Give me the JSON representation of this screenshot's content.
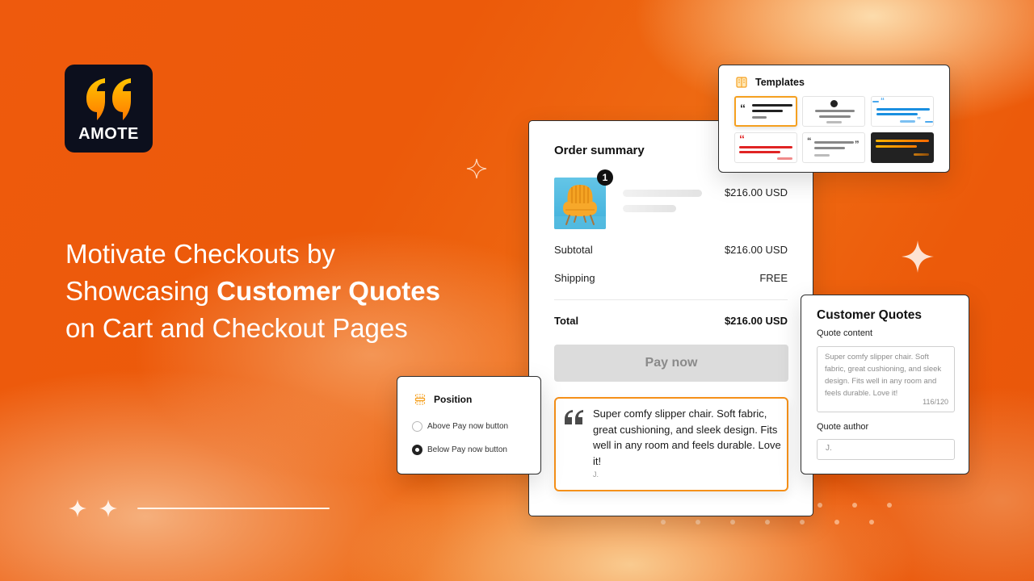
{
  "brand": {
    "logo_text": "AMOTE",
    "logo_icon": "quote-marks-icon",
    "colors": {
      "logo_bg": "#0c0f1d",
      "accent": "#f59019",
      "bg_orange": "#ec5a0a"
    }
  },
  "headline": {
    "line1": "Motivate Checkouts by",
    "line2_regular": "Showcasing ",
    "line2_bold": "Customer Quotes",
    "line3": "on Cart and Checkout Pages"
  },
  "order_summary": {
    "title": "Order summary",
    "item": {
      "image": "orange-armchair",
      "quantity_badge": "1",
      "price": "$216.00 USD"
    },
    "subtotal_label": "Subtotal",
    "subtotal_value": "$216.00 USD",
    "shipping_label": "Shipping",
    "shipping_value": "FREE",
    "total_label": "Total",
    "total_value": "$216.00 USD",
    "pay_button": "Pay now",
    "quote": {
      "text": "Super comfy slipper chair. Soft fabric, great cushioning, and sleek design. Fits well in any room and feels durable. Love it!",
      "author": "J."
    }
  },
  "templates_panel": {
    "title": "Templates",
    "icon": "book-icon",
    "items": [
      {
        "name": "classic-dark",
        "selected": true,
        "color": "#222222"
      },
      {
        "name": "centered-grey",
        "selected": false,
        "color": "#888888"
      },
      {
        "name": "blue-bordered",
        "selected": false,
        "color": "#1a8fe0"
      },
      {
        "name": "red-accent",
        "selected": false,
        "color": "#e02424"
      },
      {
        "name": "inline-quotes-grey",
        "selected": false,
        "color": "#888888"
      },
      {
        "name": "dark-gradient",
        "selected": false,
        "color": "#f59019"
      }
    ]
  },
  "position_panel": {
    "title": "Position",
    "icon": "position-icon",
    "options": [
      {
        "label": "Above Pay now button",
        "selected": false
      },
      {
        "label": "Below Pay now button",
        "selected": true
      }
    ]
  },
  "customer_quotes_panel": {
    "title": "Customer Quotes",
    "content_label": "Quote content",
    "content_value": "Super comfy slipper chair. Soft fabric, great cushioning, and sleek design. Fits well in any room and feels durable. Love it!",
    "char_count": "116/120",
    "author_label": "Quote author",
    "author_value": "J."
  }
}
